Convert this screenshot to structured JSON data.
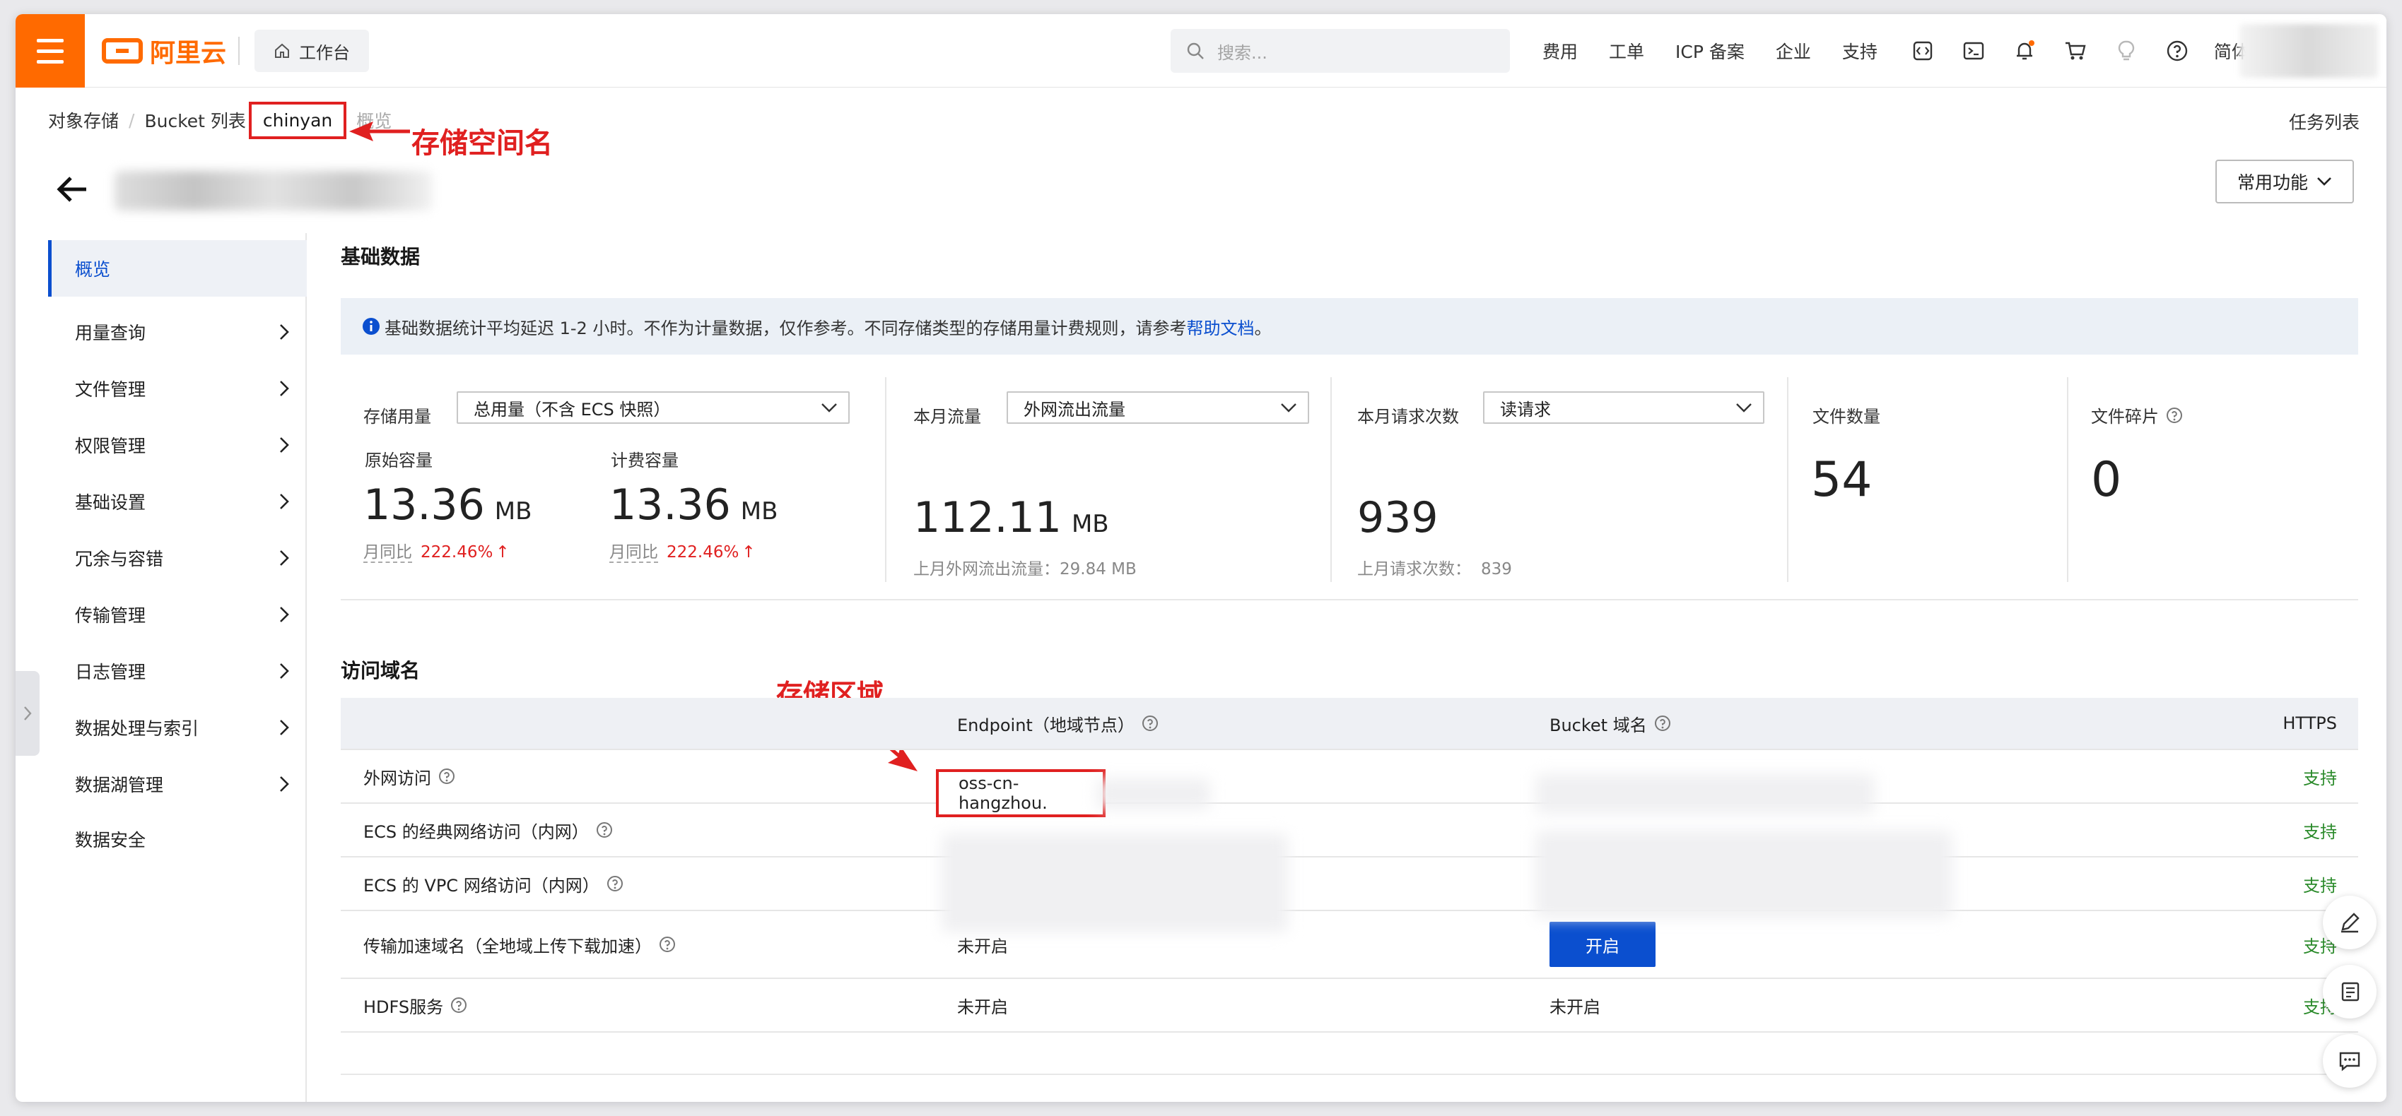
{
  "topbar": {
    "logo_text": "阿里云",
    "workbench_label": "工作台",
    "search_placeholder": "搜索...",
    "nav_items": [
      "费用",
      "工单",
      "ICP 备案",
      "企业",
      "支持"
    ],
    "lang_label": "简体",
    "brand_color": "#ff6a00",
    "icons": [
      "code-icon",
      "terminal-icon",
      "bell-icon",
      "cart-icon",
      "bulb-icon",
      "help-icon"
    ]
  },
  "breadcrumb": {
    "items": [
      "对象存储",
      "Bucket 列表"
    ],
    "current_bucket": "chinyan",
    "current_page": "概览"
  },
  "annotations": {
    "bucket_name_label": "存储空间名",
    "region_label": "存储区域",
    "color": "#e02020"
  },
  "header": {
    "task_list": "任务列表",
    "common_functions": "常用功能"
  },
  "sidebar": {
    "items": [
      {
        "label": "概览",
        "active": true,
        "has_children": false
      },
      {
        "label": "用量查询",
        "active": false,
        "has_children": true
      },
      {
        "label": "文件管理",
        "active": false,
        "has_children": true
      },
      {
        "label": "权限管理",
        "active": false,
        "has_children": true
      },
      {
        "label": "基础设置",
        "active": false,
        "has_children": true
      },
      {
        "label": "冗余与容错",
        "active": false,
        "has_children": true
      },
      {
        "label": "传输管理",
        "active": false,
        "has_children": true
      },
      {
        "label": "日志管理",
        "active": false,
        "has_children": true
      },
      {
        "label": "数据处理与索引",
        "active": false,
        "has_children": true
      },
      {
        "label": "数据湖管理",
        "active": false,
        "has_children": true
      },
      {
        "label": "数据安全",
        "active": false,
        "has_children": false
      }
    ]
  },
  "basic_data": {
    "title": "基础数据",
    "notice": "基础数据统计平均延迟 1-2 小时。不作为计量数据，仅作参考。不同存储类型的存储用量计费规则，请参考",
    "notice_link": "帮助文档",
    "notice_end": " 。",
    "storage": {
      "label": "存储用量",
      "select": "总用量（不含 ECS 快照）",
      "raw_label": "原始容量",
      "raw_value": "13.36",
      "raw_unit": "MB",
      "bill_label": "计费容量",
      "bill_value": "13.36",
      "bill_unit": "MB",
      "mom_label": "月同比",
      "mom_value": "222.46%",
      "mom_arrow": "↑"
    },
    "traffic": {
      "label": "本月流量",
      "select": "外网流出流量",
      "value": "112.11",
      "unit": "MB",
      "last_month": "上月外网流出流量：29.84 MB"
    },
    "requests": {
      "label": "本月请求次数",
      "select": "读请求",
      "value": "939",
      "last_month_label": "上月请求次数：",
      "last_month_value": "839"
    },
    "files": {
      "label": "文件数量",
      "value": "54"
    },
    "fragments": {
      "label": "文件碎片",
      "value": "0"
    }
  },
  "domains": {
    "title": "访问域名",
    "headers": [
      "",
      "Endpoint（地域节点）",
      "Bucket 域名",
      "HTTPS"
    ],
    "rows": [
      {
        "name": "外网访问",
        "endpoint": "oss-cn-hangzhou.",
        "bucket_domain": "",
        "https": "支持"
      },
      {
        "name": "ECS 的经典网络访问（内网）",
        "endpoint": "",
        "bucket_domain": "",
        "https": "支持"
      },
      {
        "name": "ECS 的 VPC 网络访问（内网）",
        "endpoint": "",
        "bucket_domain": "",
        "https": "支持"
      },
      {
        "name": "传输加速域名（全地域上传下载加速）",
        "endpoint": "未开启",
        "bucket_domain": "",
        "https": "支持",
        "action": "开启"
      },
      {
        "name": "HDFS服务",
        "endpoint": "未开启",
        "bucket_domain": "未开启",
        "https": "支持"
      }
    ]
  },
  "floating_icons": [
    "edit-icon",
    "document-icon",
    "chat-icon"
  ]
}
